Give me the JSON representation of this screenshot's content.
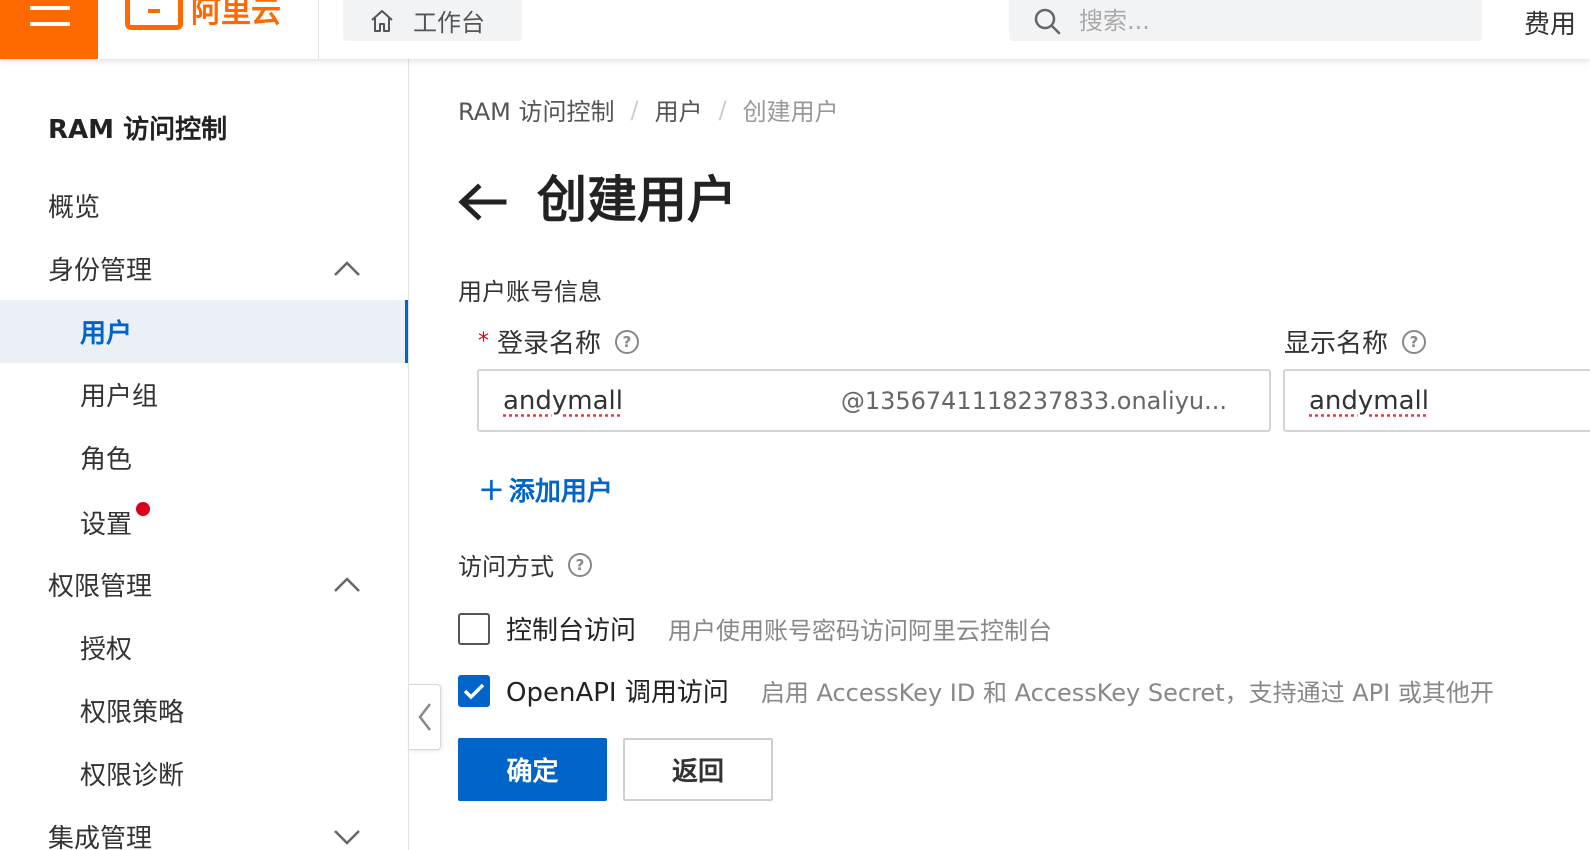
{
  "topbar": {
    "brand": "阿里云",
    "workbench": "工作台",
    "search_placeholder": "搜索...",
    "fee": "费用"
  },
  "sidebar": {
    "title": "RAM 访问控制",
    "items": [
      {
        "label": "概览"
      },
      {
        "label": "身份管理"
      },
      {
        "label": "用户"
      },
      {
        "label": "用户组"
      },
      {
        "label": "角色"
      },
      {
        "label": "设置"
      },
      {
        "label": "权限管理"
      },
      {
        "label": "授权"
      },
      {
        "label": "权限策略"
      },
      {
        "label": "权限诊断"
      },
      {
        "label": "集成管理"
      }
    ]
  },
  "breadcrumb": [
    "RAM 访问控制",
    "用户",
    "创建用户"
  ],
  "page": {
    "title": "创建用户",
    "account_section": "用户账号信息",
    "login_name_label": "登录名称",
    "login_name_value": "andymall",
    "login_name_suffix": "@1356741118237833.onaliyu...",
    "display_name_label": "显示名称",
    "display_name_value": "andymall",
    "add_user": "添加用户",
    "access_section": "访问方式",
    "console_access_label": "控制台访问",
    "console_access_desc": "用户使用账号密码访问阿里云控制台",
    "console_access_checked": false,
    "openapi_label": "OpenAPI 调用访问",
    "openapi_desc": "启用 AccessKey ID 和 AccessKey Secret，支持通过 API 或其他开",
    "openapi_checked": true,
    "confirm": "确定",
    "back": "返回"
  },
  "colors": {
    "brand_orange": "#ff6a00",
    "primary_blue": "#0064c8",
    "required_red": "#d9001b"
  }
}
